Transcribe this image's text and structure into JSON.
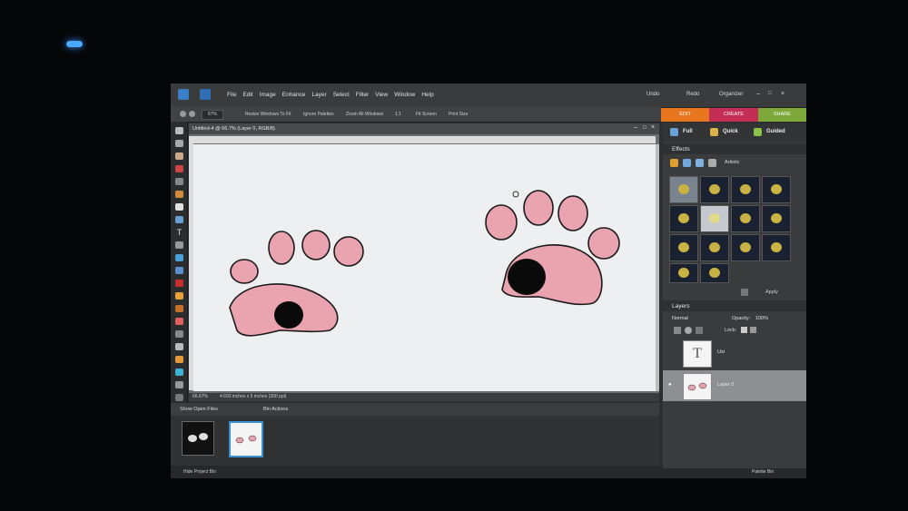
{
  "app": {
    "menu": [
      "File",
      "Edit",
      "Image",
      "Enhance",
      "Layer",
      "Select",
      "Filter",
      "View",
      "Window",
      "Help"
    ],
    "undo": "Undo",
    "redo": "Redo",
    "organizer": "Organizer"
  },
  "options": {
    "zoom": "67%",
    "resize": "Resize Windows To Fit",
    "ignore": "Ignore Palettes",
    "zoom_all": "Zoom All Windows",
    "one_to_one": "1:1",
    "fit_screen": "Fit Screen",
    "print_size": "Print Size"
  },
  "modes": {
    "edit": "EDIT",
    "create": "CREATE",
    "share": "SHARE",
    "full": "Full",
    "quick": "Quick",
    "guided": "Guided"
  },
  "document": {
    "title": "Untitled-4 @ 66.7% (Layer 0, RGB/8)",
    "zoom_status": "66.67%",
    "size_status": "4.693 inches x 5 inches (300 ppi)"
  },
  "bin": {
    "show": "Show Open Files",
    "actions": "Bin Actions",
    "hide": "Hide Project Bin"
  },
  "effects": {
    "title": "Effects",
    "category": "Artistic",
    "apply": "Apply"
  },
  "layers": {
    "title": "Layers",
    "blend": "Normal",
    "opacity_label": "Opacity:",
    "opacity_value": "100%",
    "lock_label": "Lock:",
    "items": [
      {
        "name": "Usi"
      },
      {
        "name": "Layer 0"
      }
    ]
  },
  "palette_bin": "Palette Bin",
  "colors": {
    "edit_tab": "#e8761e",
    "create_tab": "#c42d56",
    "share_tab": "#7ea83a",
    "paw_pink": "#eaa4b0",
    "accent_orange": "#e07020"
  }
}
